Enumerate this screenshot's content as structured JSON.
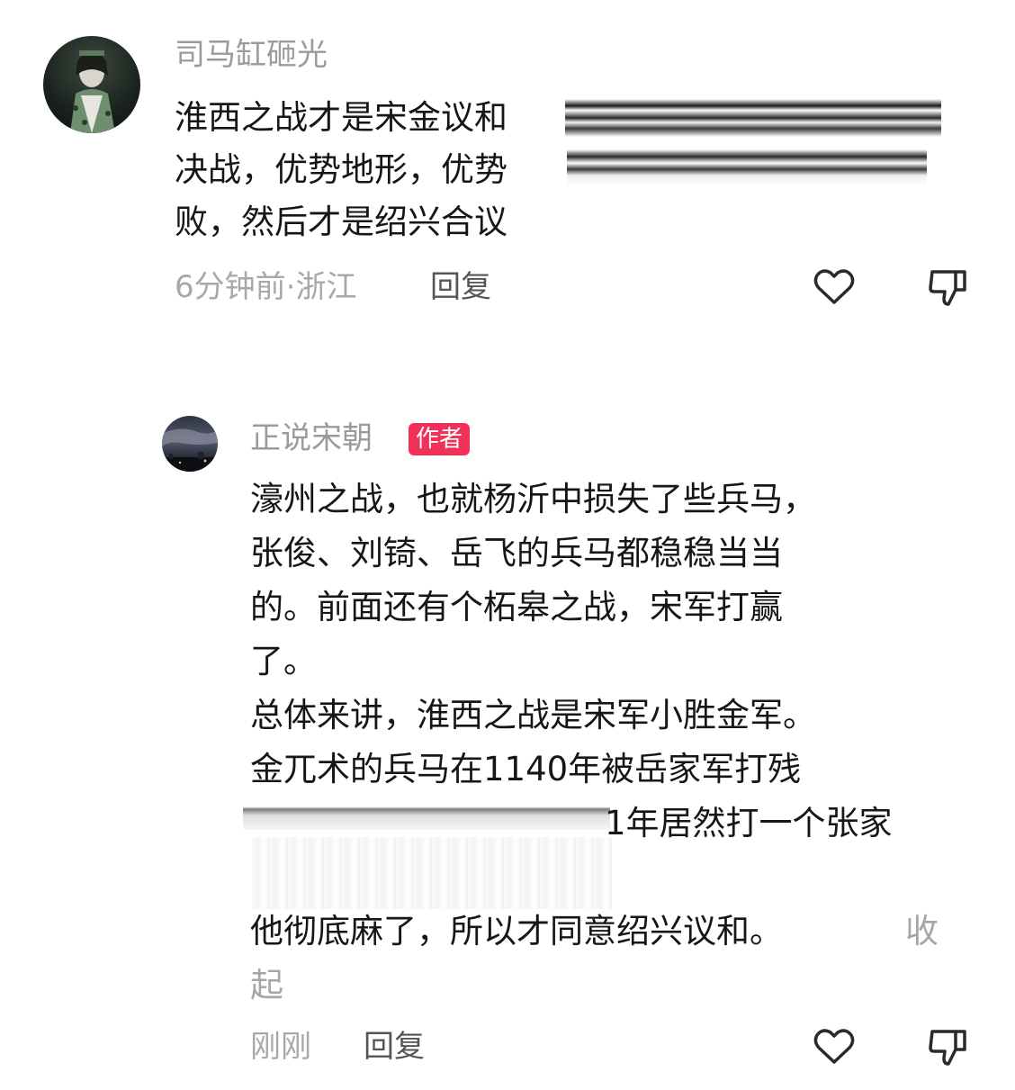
{
  "comments": [
    {
      "user": "司马缸砸光",
      "lines": [
        "淮西之战才是宋金议和",
        "决战，优势地形，优势",
        "败，然后才是绍兴合议"
      ],
      "meta": "6分钟前·浙江",
      "reply_label": "回复",
      "icons": {
        "like": "heart-outline-icon",
        "dislike": "thumbs-down-outline-icon"
      }
    },
    {
      "user": "正说宋朝",
      "badge": "作者",
      "lines": [
        "濠州之战，也就杨沂中损失了些兵马，",
        "张俊、刘锜、岳飞的兵马都稳稳当当",
        "的。前面还有个柘皋之战，宋军打赢",
        "了。",
        "总体来讲，淮西之战是宋军小胜金军。",
        "金兀术的兵马在1140年被岳家军打残",
        "1年居然打一个张家",
        "他彻底麻了，所以才同意绍兴议和。"
      ],
      "collapse_label_1": "收",
      "collapse_label_2": "起",
      "meta": "刚刚",
      "reply_label": "回复",
      "icons": {
        "like": "heart-outline-icon",
        "dislike": "thumbs-down-outline-icon"
      }
    }
  ],
  "colors": {
    "name_gray": "#9b9b9b",
    "badge_red": "#f0325a",
    "text": "#161616"
  }
}
